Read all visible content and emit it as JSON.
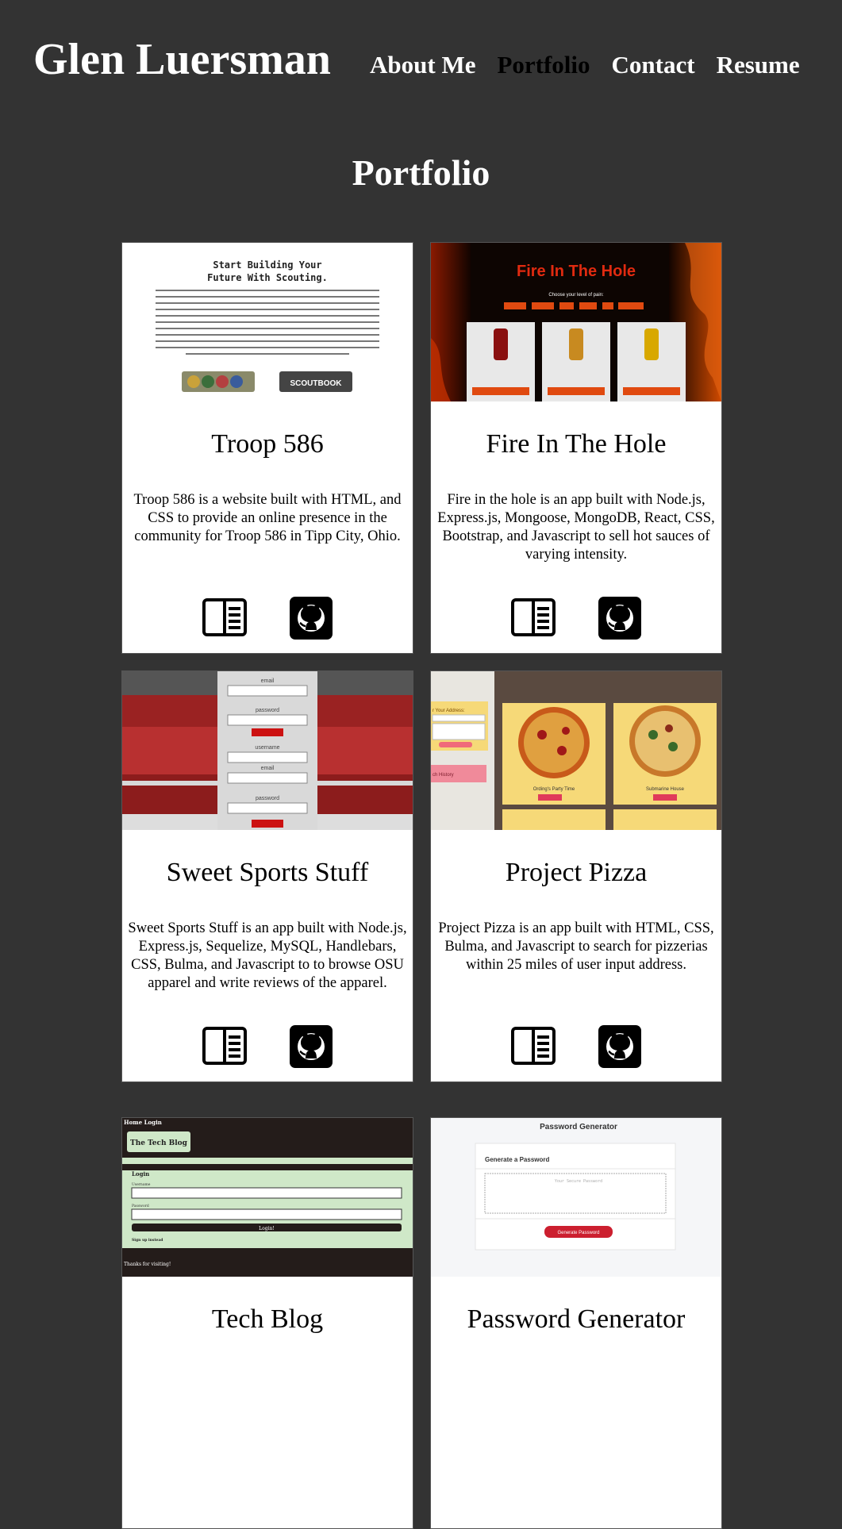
{
  "header": {
    "brand": "Glen Luersman",
    "nav": [
      "About Me",
      "Portfolio",
      "Contact",
      "Resume"
    ]
  },
  "page": {
    "title": "Portfolio"
  },
  "projects": [
    {
      "title": "Troop 586",
      "description": "Troop 586 is a website built with HTML, and CSS to provide an online presence in the community for Troop 586 in Tipp City, Ohio.",
      "thumb": {
        "heading1": "Start Building Your",
        "heading2": "Future With Scouting.",
        "badge": "SCOUTBOOK"
      }
    },
    {
      "title": "Fire In The Hole",
      "description": "Fire in the hole is an app built with Node.js, Express.js, Mongoose, MongoDB, React, CSS, Bootstrap, and Javascript to sell hot sauces of varying intensity.",
      "thumb": {
        "banner": "Fire In The Hole",
        "prompt": "Choose your level of pain:"
      }
    },
    {
      "title": "Sweet Sports Stuff",
      "description": "Sweet Sports Stuff is an app built with Node.js, Express.js, Sequelize, MySQL, Handlebars, CSS, Bulma, and Javascript to to browse OSU apparel and write reviews of the apparel.",
      "thumb": {
        "labels": [
          "email",
          "password",
          "username",
          "email",
          "password"
        ]
      }
    },
    {
      "title": "Project Pizza",
      "description": "Project Pizza is an app built with HTML, CSS, Bulma, and Javascript to search for pizzerias within 25 miles of user input address.",
      "thumb": {
        "address_label": "r Your Address:",
        "history": "ch History",
        "pizza1": "Ording's Party Time",
        "pizza2": "Submarine House"
      }
    },
    {
      "title": "Tech Blog",
      "description": "",
      "thumb": {
        "nav": "Home   Login",
        "blog": "The Tech Blog",
        "login": "Login",
        "username": "Username",
        "password": "Password",
        "button": "Login!",
        "signup": "Sign up instead",
        "footer": "Thanks for visiting!"
      }
    },
    {
      "title": "Password Generator",
      "description": "",
      "thumb": {
        "header": "Password Generator",
        "card_title": "Generate a Password",
        "placeholder": "Your Secure Password",
        "button": "Generate Password"
      }
    }
  ],
  "colors": {
    "background": "#333333",
    "card": "#ffffff",
    "active_nav": "#000000"
  }
}
